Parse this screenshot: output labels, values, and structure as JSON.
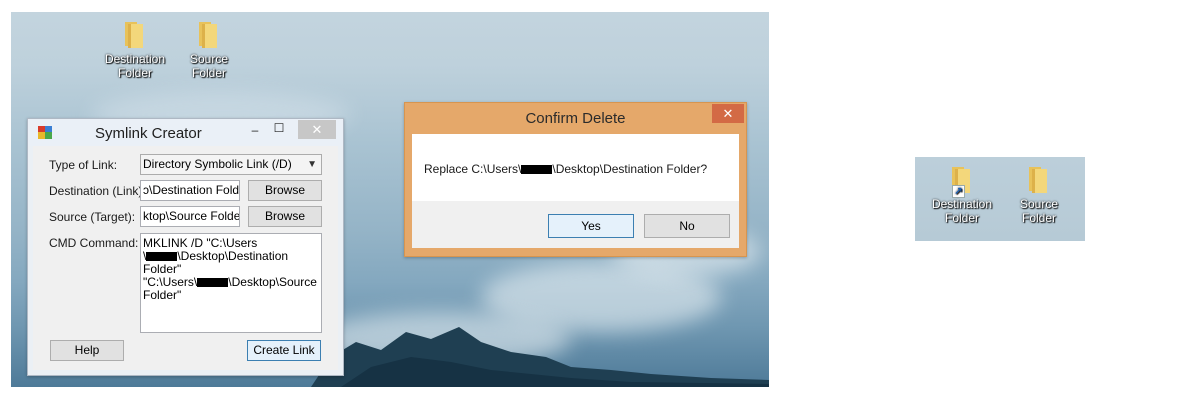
{
  "desktop": {
    "icons": [
      {
        "label": "Destination Folder"
      },
      {
        "label": "Source Folder"
      }
    ]
  },
  "symlink_window": {
    "title": "Symlink Creator",
    "minimize": "–",
    "maximize": "☐",
    "close": "✕",
    "type_label": "Type of Link:",
    "type_value": "Directory Symbolic Link (/D)",
    "destination_label": "Destination (Link):",
    "destination_value": "ɔ\\Destination Folder",
    "source_label": "Source (Target):",
    "source_value": "ktop\\Source Folder",
    "browse_label": "Browse",
    "cmd_label": "CMD Command:",
    "cmd_line1": "MKLINK /D \"C:\\Users",
    "cmd_line2_pre": "\\",
    "cmd_line2_post": "\\Desktop\\Destination Folder\"",
    "cmd_line3_pre": "\"C:\\Users\\",
    "cmd_line3_post": "\\Desktop\\Source",
    "cmd_line4": "Folder\"",
    "help_label": "Help",
    "create_label": "Create Link"
  },
  "confirm_dialog": {
    "title": "Confirm Delete",
    "close": "✕",
    "message_pre": "Replace C:\\Users\\",
    "message_post": "\\Desktop\\Destination Folder?",
    "yes_label": "Yes",
    "no_label": "No"
  },
  "inset": {
    "icons": [
      {
        "label": "Destination Folder",
        "shortcut": true
      },
      {
        "label": "Source Folder",
        "shortcut": false
      }
    ]
  },
  "colors": {
    "confirm_frame": "#e5a86a",
    "confirm_close": "#d36a45",
    "folder": "#f0cf6d"
  }
}
